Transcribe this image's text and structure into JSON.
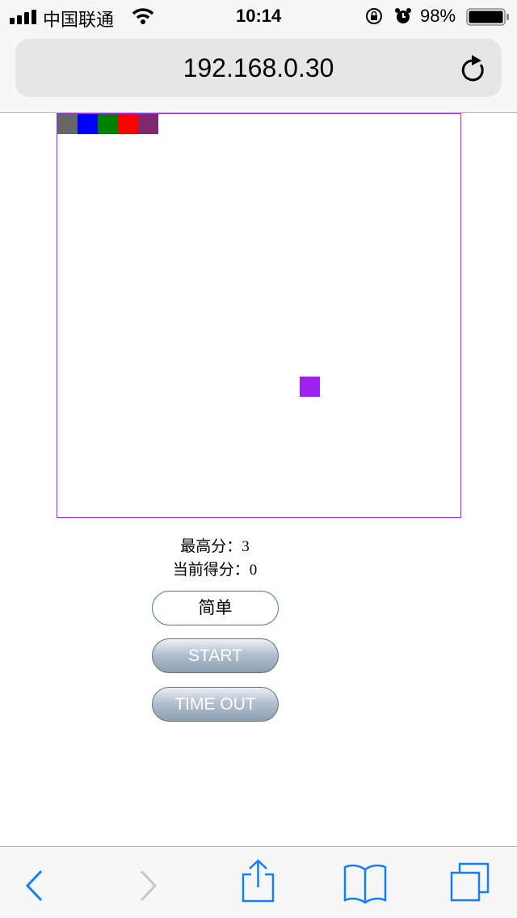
{
  "status_bar": {
    "carrier": "中国联通",
    "time": "10:14",
    "battery": "98%",
    "icons": [
      "signal-icon",
      "wifi-icon",
      "rotation-lock-icon",
      "alarm-icon",
      "battery-icon"
    ]
  },
  "browser": {
    "url": "192.168.0.30",
    "reload_icon": "reload-icon"
  },
  "game": {
    "border_color": "#9a2be6",
    "grid": {
      "columns": 20,
      "rows": 20
    },
    "snake": [
      {
        "col": 0,
        "row": 0,
        "color": "#666666"
      },
      {
        "col": 1,
        "row": 0,
        "color": "#0000ff"
      },
      {
        "col": 2,
        "row": 0,
        "color": "#008000"
      },
      {
        "col": 3,
        "row": 0,
        "color": "#ff0000"
      },
      {
        "col": 4,
        "row": 0,
        "color": "#80286e"
      }
    ],
    "food": {
      "col": 12,
      "row": 13,
      "color": "#a020f0"
    }
  },
  "scores": {
    "high_label": "最高分：",
    "high_value": "3",
    "current_label": "当前得分：",
    "current_value": "0"
  },
  "buttons": {
    "level": "简单",
    "start": "START",
    "timeout": "TIME OUT"
  },
  "toolbar": [
    "back-icon",
    "forward-icon",
    "share-icon",
    "bookmarks-icon",
    "tabs-icon"
  ]
}
